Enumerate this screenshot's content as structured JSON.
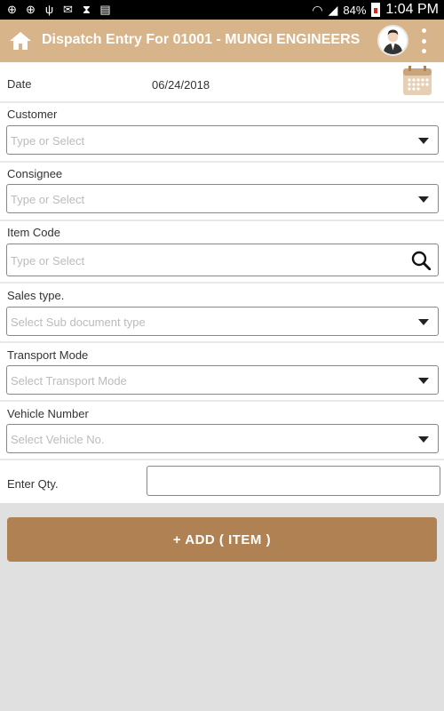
{
  "status_bar": {
    "battery": "84%",
    "time": "1:04 PM"
  },
  "app_bar": {
    "title": "Dispatch Entry For 01001 - MUNGI ENGINEERS"
  },
  "form": {
    "date": {
      "label": "Date",
      "value": "06/24/2018"
    },
    "customer": {
      "label": "Customer",
      "placeholder": "Type or Select"
    },
    "consignee": {
      "label": "Consignee",
      "placeholder": "Type or Select"
    },
    "item_code": {
      "label": "Item Code",
      "placeholder": "Type or Select"
    },
    "sales_type": {
      "label": "Sales type.",
      "placeholder": "Select Sub document type"
    },
    "transport_mode": {
      "label": "Transport Mode",
      "placeholder": "Select Transport Mode"
    },
    "vehicle_number": {
      "label": "Vehicle Number",
      "placeholder": "Select Vehicle No."
    },
    "qty": {
      "label": "Enter Qty.",
      "value": ""
    }
  },
  "actions": {
    "add_item": "+ ADD ( ITEM )"
  },
  "colors": {
    "app_bar": "#d8b48a",
    "button": "#b08152",
    "background": "#e0e0e0"
  }
}
